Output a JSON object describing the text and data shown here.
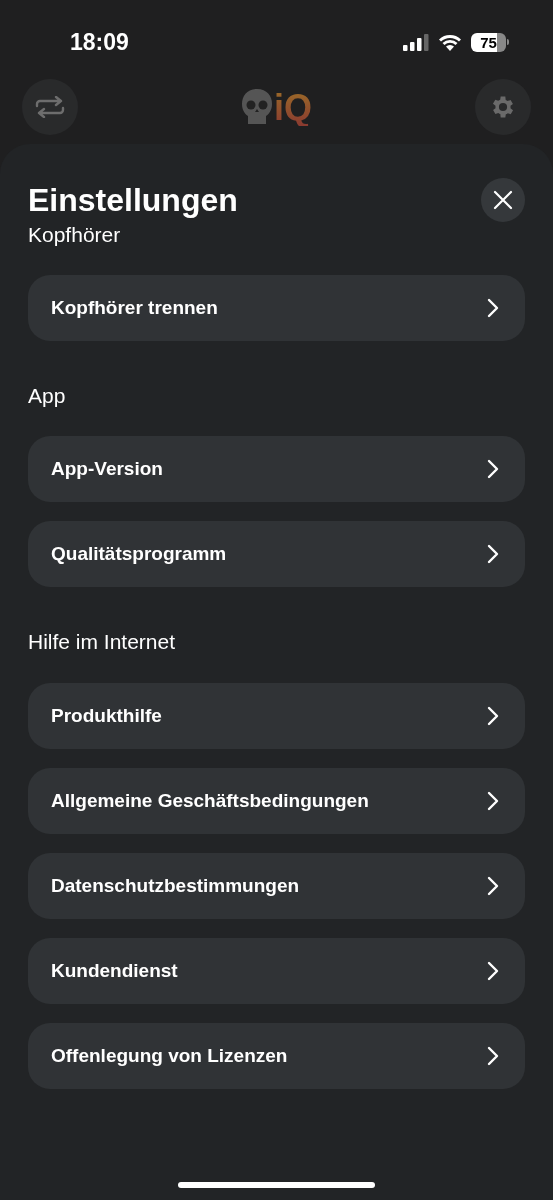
{
  "status_bar": {
    "time": "18:09",
    "battery": "75"
  },
  "header": {
    "logo_text": "iQ"
  },
  "sheet": {
    "title": "Einstellungen",
    "sections": [
      {
        "title": "Kopfhörer",
        "items": [
          {
            "label": "Kopfhörer trennen"
          }
        ]
      },
      {
        "title": "App",
        "items": [
          {
            "label": "App-Version"
          },
          {
            "label": "Qualitätsprogramm"
          }
        ]
      },
      {
        "title": "Hilfe im Internet",
        "items": [
          {
            "label": "Produkthilfe"
          },
          {
            "label": "Allgemeine Geschäftsbedingungen"
          },
          {
            "label": "Datenschutzbestimmungen"
          },
          {
            "label": "Kundendienst"
          },
          {
            "label": "Offenlegung von Lizenzen"
          }
        ]
      }
    ]
  }
}
